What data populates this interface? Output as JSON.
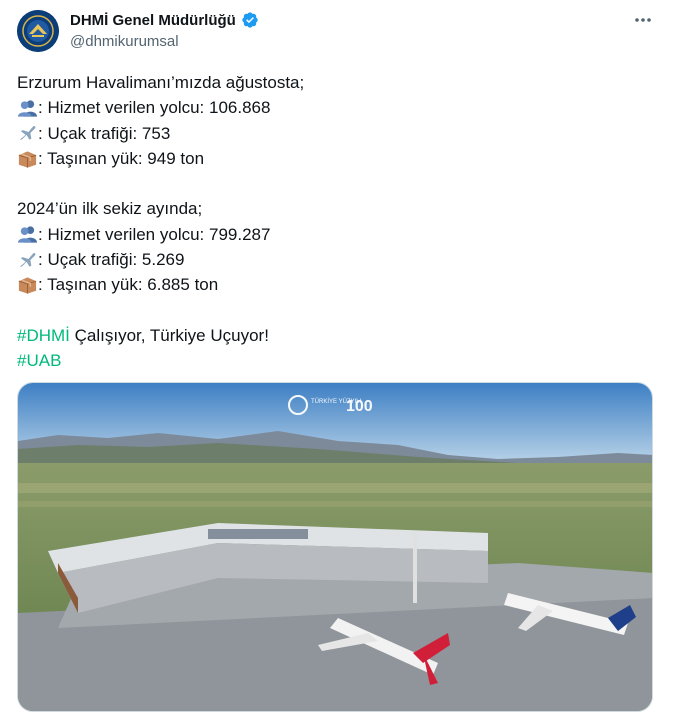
{
  "author": {
    "display_name": "DHMİ Genel Müdürlüğü",
    "handle": "@dhmikurumsal",
    "verified": true,
    "avatar_icon": "dhmi-emblem-icon"
  },
  "tweet": {
    "lines": {
      "intro1": "Erzurum Havalimanı’mızda ağustosta;",
      "aug_passengers": ": Hizmet verilen yolcu: 106.868",
      "aug_traffic": ": Uçak trafiği: 753",
      "aug_cargo": ": Taşınan yük: 949 ton",
      "intro2": "2024’ün ilk sekiz ayında;",
      "ytd_passengers": ": Hizmet verilen yolcu: 799.287",
      "ytd_traffic": ": Uçak trafiği: 5.269",
      "ytd_cargo": ": Taşınan yük: 6.885 ton",
      "hashtag1": "#DHMİ",
      "slogan": " Çalışıyor, Türkiye Uçuyor!",
      "hashtag2": "#UAB"
    },
    "emoji_icons": [
      "people-icon",
      "airplane-icon",
      "package-icon"
    ]
  },
  "media": {
    "image_icon": "airport-aerial-photo",
    "overlay_logo_text": "TÜRKİYE YÜZYILI",
    "overlay_100_text": "100"
  },
  "colors": {
    "hashtag": "#00ba7c",
    "verified": "#1d9bf0",
    "secondary_text": "#536471"
  }
}
